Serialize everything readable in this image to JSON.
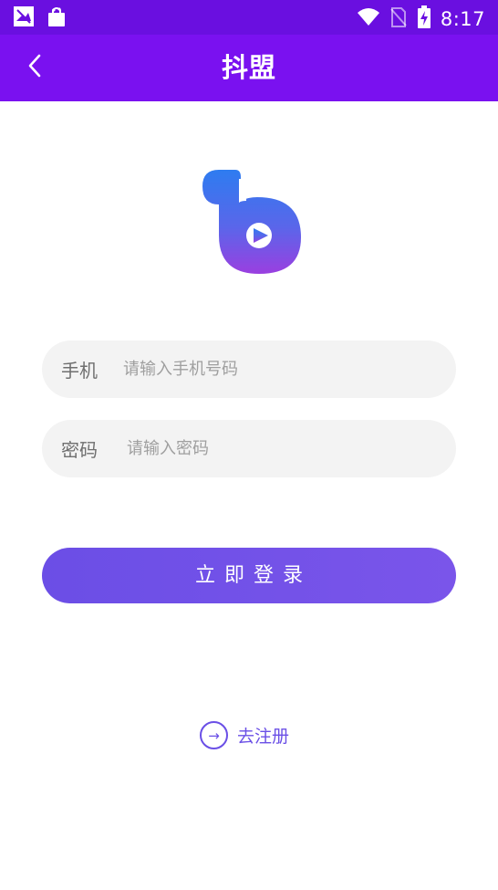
{
  "status_bar": {
    "time": "8:17",
    "left_icons": [
      "gallery-icon",
      "shopping-bag-icon"
    ],
    "right_icons": [
      "wifi-icon",
      "no-sim-icon",
      "battery-charging-icon"
    ]
  },
  "header": {
    "title": "抖盟",
    "back_icon": "chevron-left-icon"
  },
  "logo": {
    "icon": "app-logo-icon"
  },
  "form": {
    "phone_label": "手机",
    "phone_placeholder": "请输入手机号码",
    "password_label": "密码",
    "password_placeholder": "请输入密码"
  },
  "actions": {
    "login_label": "立即登录",
    "register_label": "去注册",
    "register_icon_glyph": "→"
  },
  "colors": {
    "status_bar": "#6a0fe0",
    "header": "#7a11f0",
    "accent": "#6b4ee6",
    "field_bg": "#f3f3f3"
  }
}
